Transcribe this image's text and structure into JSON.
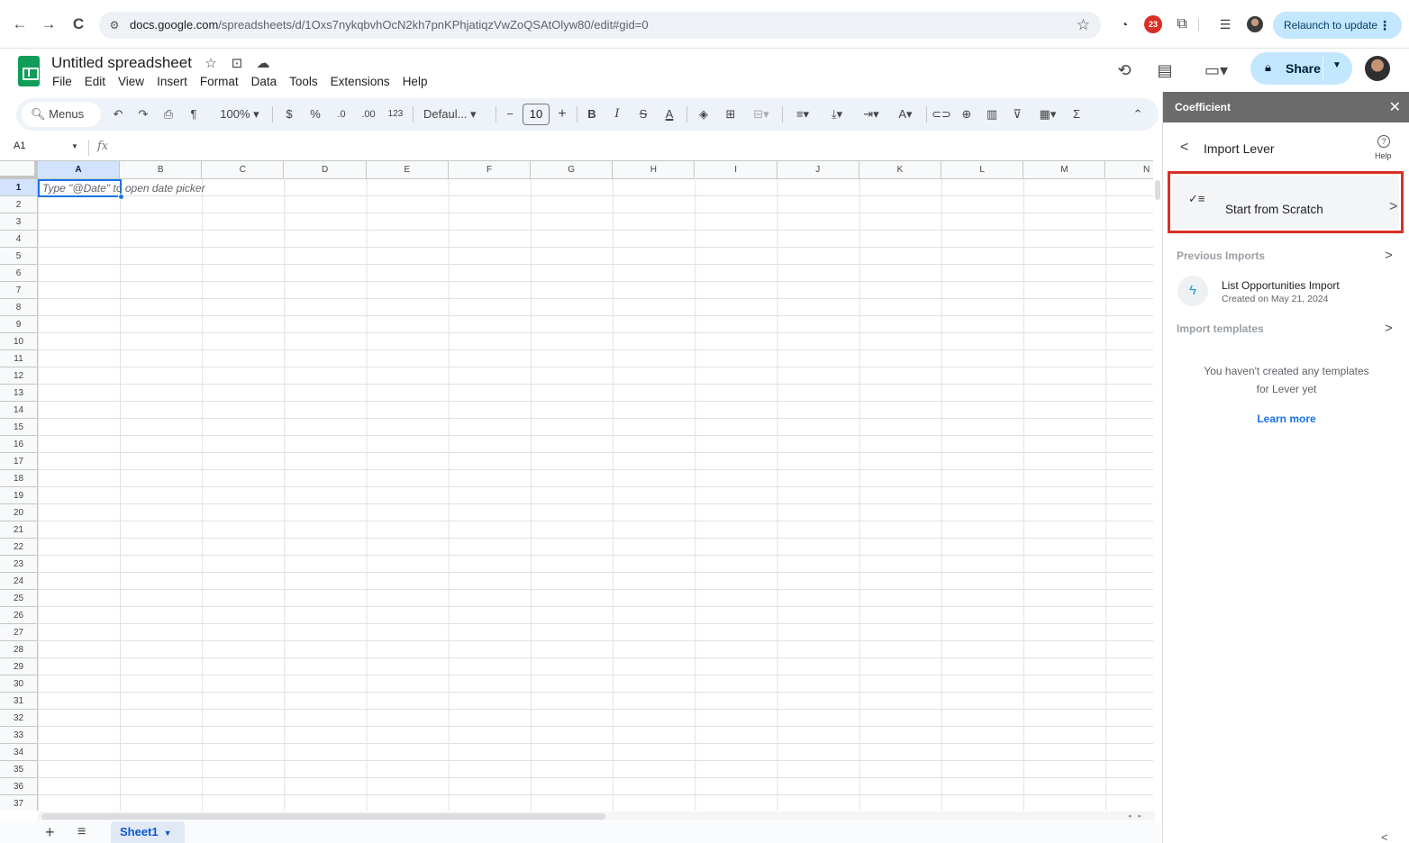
{
  "browser": {
    "url_host": "docs.google.com",
    "url_path": "/spreadsheets/d/1Oxs7nykqbvhOcN2kh7pnKPhjatiqzVwZoQSAtOlyw80/edit#gid=0",
    "extension_badge": "23",
    "relaunch_label": "Relaunch to update",
    "back_glyph": "←",
    "forward_glyph": "→",
    "reload_glyph": "C",
    "star_glyph": "☆",
    "menu_glyph": "⋮"
  },
  "doc": {
    "title": "Untitled spreadsheet",
    "menu": [
      "File",
      "Edit",
      "View",
      "Insert",
      "Format",
      "Data",
      "Tools",
      "Extensions",
      "Help"
    ],
    "share_label": "Share"
  },
  "toolbar": {
    "search_label": "Menus",
    "zoom": "100%",
    "currency": "$",
    "percent": "%",
    "dec_decrease": ".0",
    "dec_increase": ".00",
    "number_format": "123",
    "font": "Defaul...",
    "font_size": "10",
    "bold": "B",
    "italic": "I",
    "strike": "S",
    "text_color": "A",
    "sum": "Σ"
  },
  "formula_bar": {
    "name_box": "A1",
    "fx": "fx"
  },
  "grid": {
    "columns": [
      "A",
      "B",
      "C",
      "D",
      "E",
      "F",
      "G",
      "H",
      "I",
      "J",
      "K",
      "L",
      "M",
      "N"
    ],
    "rows": [
      "1",
      "2",
      "3",
      "4",
      "5",
      "6",
      "7",
      "8",
      "9",
      "10",
      "11",
      "12",
      "13",
      "14",
      "15",
      "16",
      "17",
      "18",
      "19",
      "20",
      "21",
      "22",
      "23",
      "24",
      "25",
      "26",
      "27",
      "28",
      "29",
      "30",
      "31",
      "32",
      "33",
      "34",
      "35",
      "36",
      "37"
    ],
    "selected_column": "A",
    "selected_row": "1",
    "cell_hint": "Type \"@Date\" to open date picker"
  },
  "sheets": {
    "add_glyph": "+",
    "list_glyph": "≡",
    "active_tab": "Sheet1"
  },
  "panel": {
    "title": "Coefficient",
    "close_glyph": "✕",
    "heading": "Import Lever",
    "help_label": "Help",
    "start_label": "Start from Scratch",
    "previous_label": "Previous Imports",
    "previous_item_name": "List Opportunities Import",
    "previous_item_date": "Created on May 21, 2024",
    "templates_label": "Import templates",
    "empty_message": "You haven't created any templates for Lever yet",
    "learn_more": "Learn more",
    "chevron_right": ">",
    "chevron_left": "<"
  },
  "colors": {
    "accent_blue": "#1a73e8",
    "share_bg": "#c2e7ff",
    "sheets_green": "#0f9d58",
    "highlight_red": "#d93025",
    "panel_header": "#6b6b6b"
  }
}
